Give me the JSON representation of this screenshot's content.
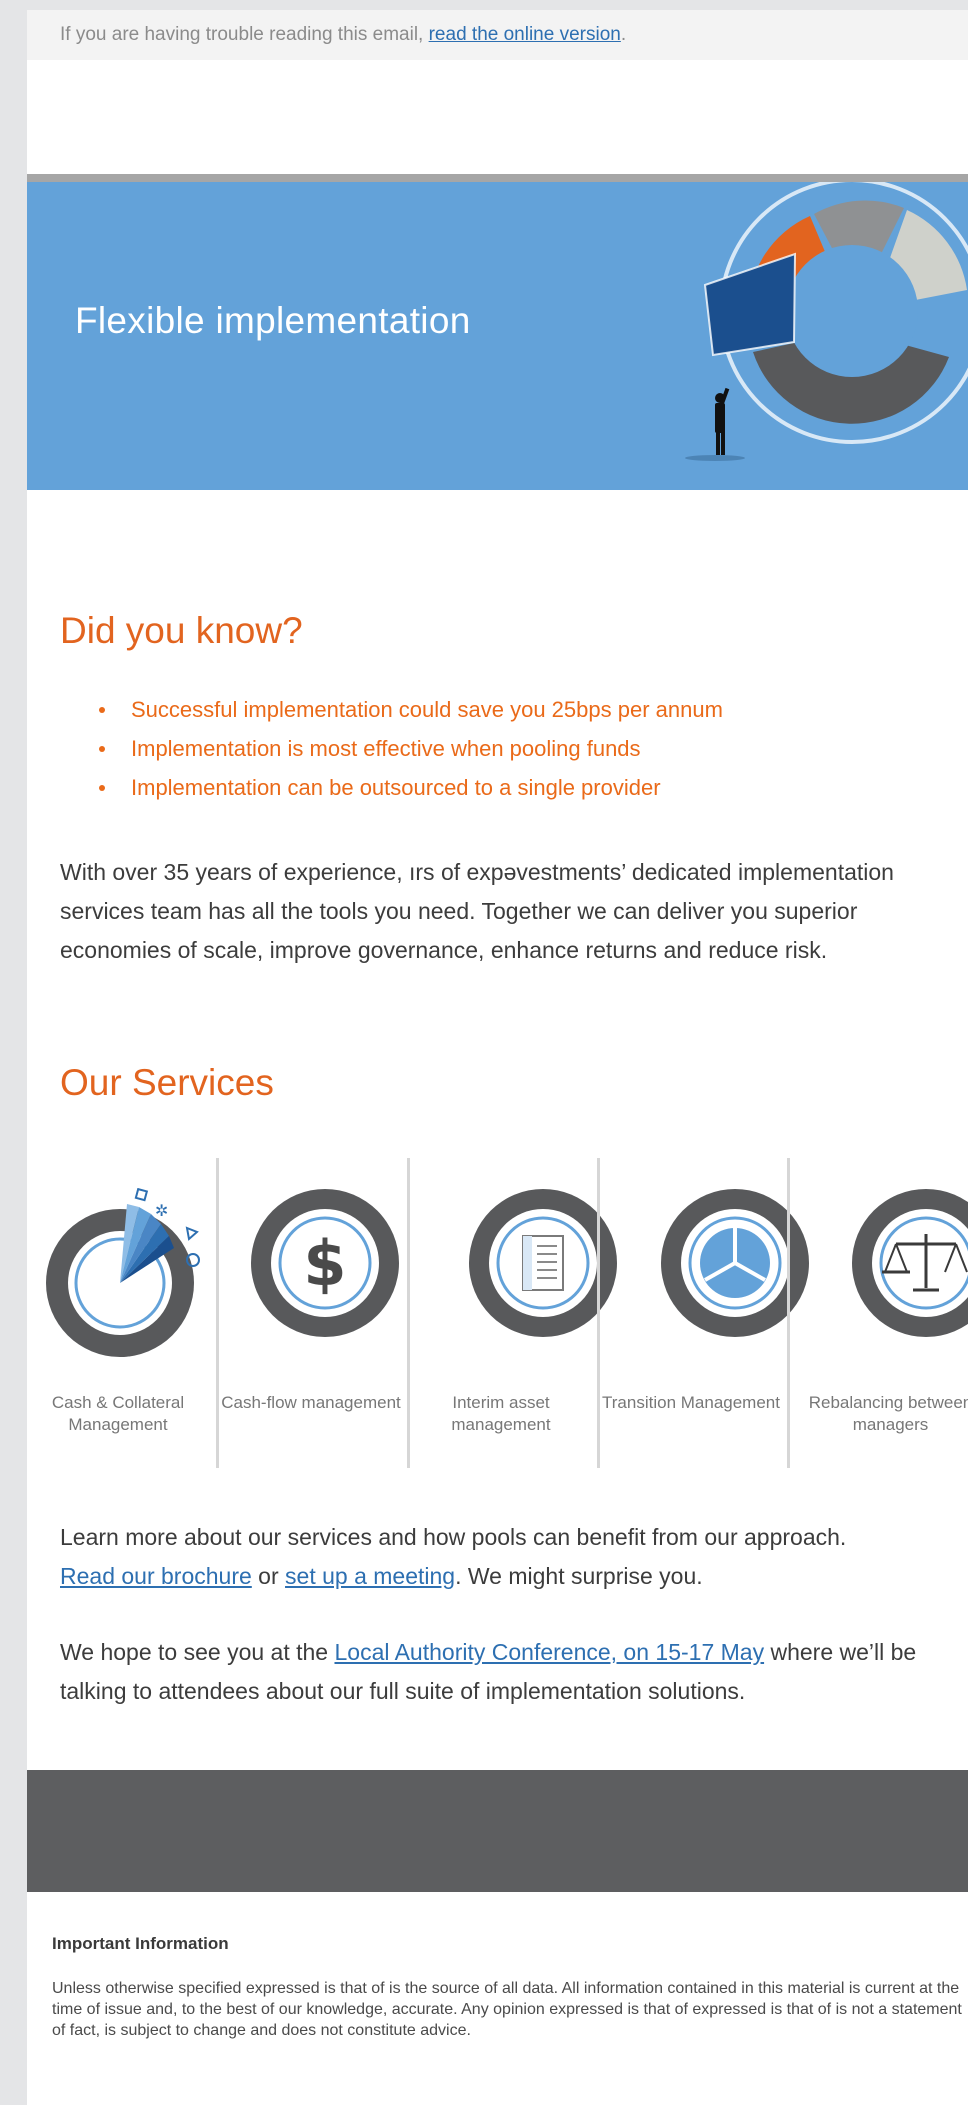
{
  "preheader": {
    "text": "If you are having trouble reading this email, ",
    "link": "read the online version",
    "suffix": "."
  },
  "hero": {
    "title": "Flexible implementation"
  },
  "did_you_know": {
    "title": "Did you know?",
    "bullets": [
      "Successful implementation could save you 25bps per annum",
      "Implementation is most effective when pooling funds",
      "Implementation can be outsourced to a single provider"
    ]
  },
  "intro": {
    "text": "With over 35 years of experience, ırs of expəvestments’ dedicated implementation services team has all the tools you need. Together we can deliver you superior economies of scale, improve governance, enhance returns and reduce risk."
  },
  "services": {
    "title": "Our Services",
    "items": [
      {
        "label": "Cash & Collateral Management",
        "icon": "cash-collateral-icon"
      },
      {
        "label": "Cash-flow management",
        "icon": "dollar-icon"
      },
      {
        "label": "Interim asset management",
        "icon": "document-icon"
      },
      {
        "label": "Transition Management",
        "icon": "pie-chart-icon"
      },
      {
        "label": "Rebalancing between managers",
        "icon": "scales-icon"
      }
    ]
  },
  "learn_more": {
    "text": "Learn more about our services and how pools can benefit from our approach.",
    "brochure_link": "Read our brochure",
    "or": " or ",
    "meeting_link": "set up a meeting",
    "suffix": ". We might surprise you."
  },
  "conference": {
    "prefix": "We hope to see you at the ",
    "link": "Local Authority Conference, on 15-17 May",
    "suffix": "where we’ll be talking to attendees about our full suite of implementation solutions."
  },
  "important": {
    "heading": "Important Information",
    "text": "Unless otherwise specified expressed is that of  is the source of all data. All information contained in this material is current at the time of issue and, to the best of our knowledge, accurate. Any opinion expressed is that of  expressed is that of is not a statement of fact, is subject to change and does not constitute advice."
  },
  "colors": {
    "hero_blue": "#63a2d9",
    "accent_orange": "#e2641f",
    "link_blue": "#2d6fb1",
    "dark_band": "#5d5e60"
  }
}
